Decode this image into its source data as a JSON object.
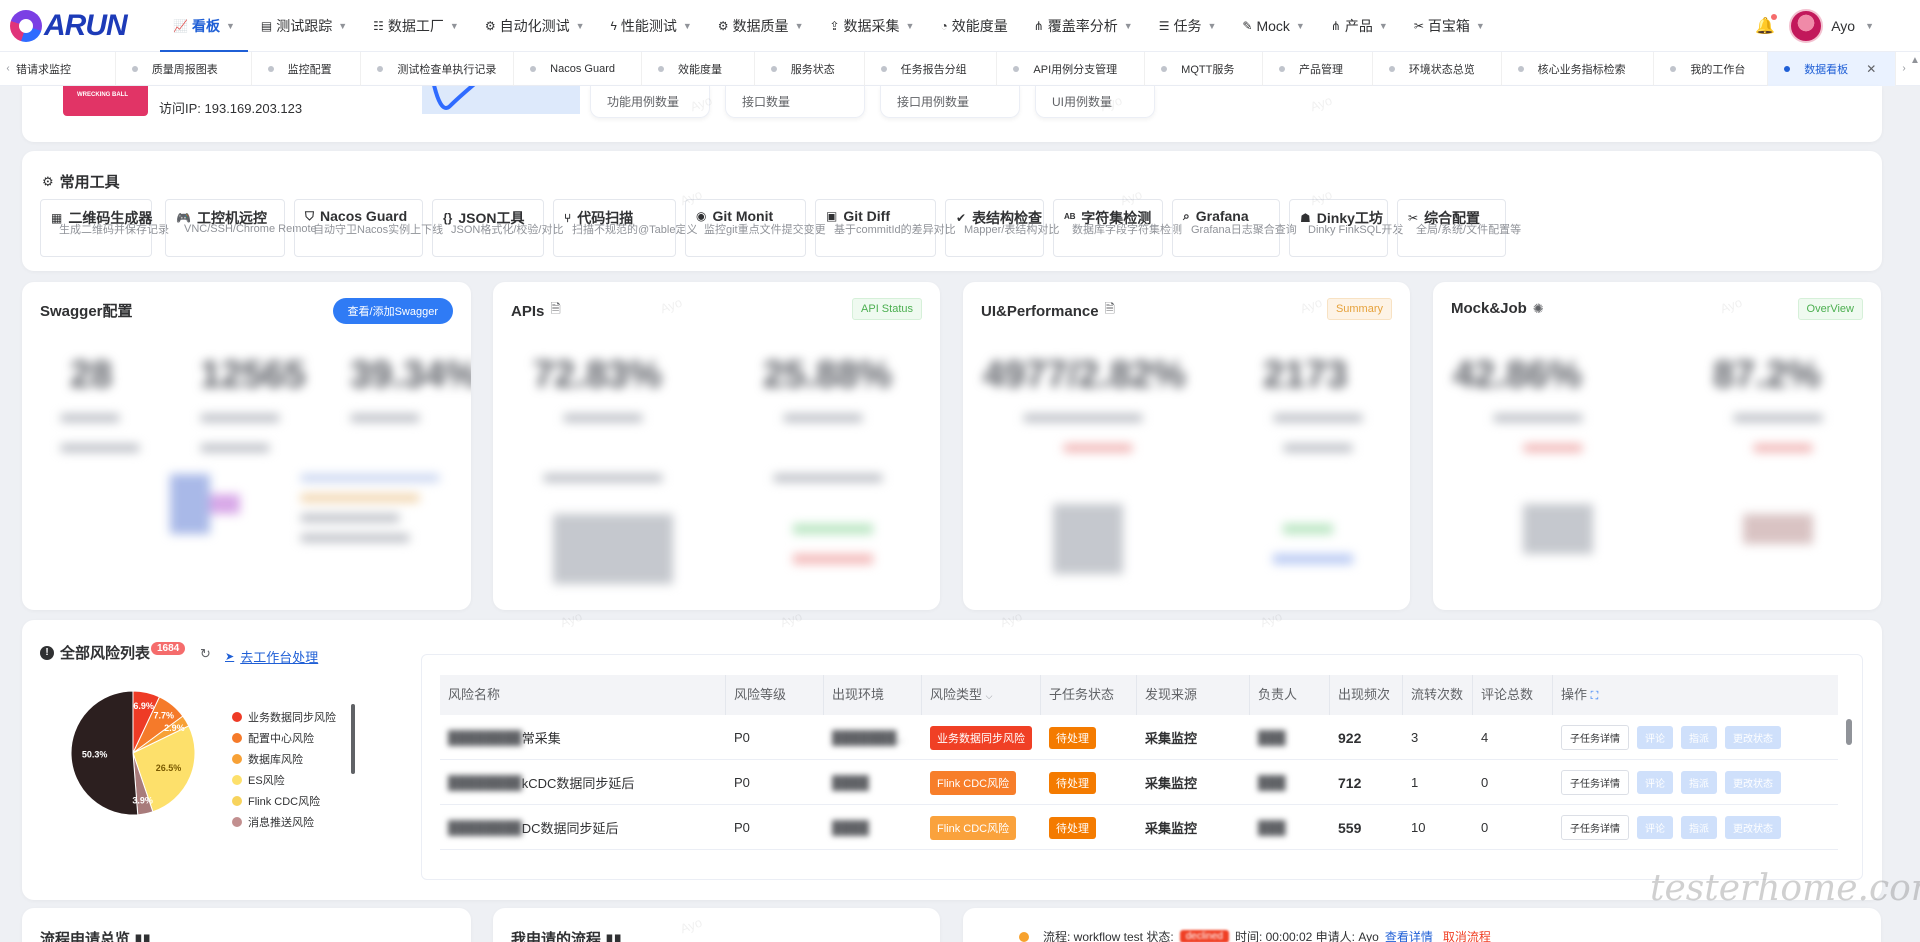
{
  "brand": {
    "logo_text": "ARUN"
  },
  "nav": {
    "items": [
      {
        "icon": "chart-icon",
        "glyph": "📈",
        "label": "看板",
        "active": true,
        "caret": true
      },
      {
        "icon": "doc-icon",
        "glyph": "▤",
        "label": "测试跟踪",
        "caret": true
      },
      {
        "icon": "database-icon",
        "glyph": "☷",
        "label": "数据工厂",
        "caret": true
      },
      {
        "icon": "robot-icon",
        "glyph": "⚙",
        "label": "自动化测试",
        "caret": true
      },
      {
        "icon": "bolt-icon",
        "glyph": "ϟ",
        "label": "性能测试",
        "caret": true
      },
      {
        "icon": "robot-icon",
        "glyph": "⚙",
        "label": "数据质量",
        "caret": true
      },
      {
        "icon": "upload-icon",
        "glyph": "⇪",
        "label": "数据采集",
        "caret": true
      },
      {
        "icon": "pie-icon",
        "glyph": "◔",
        "label": "效能度量",
        "caret": false
      },
      {
        "icon": "nodes-icon",
        "glyph": "⋔",
        "label": "覆盖率分析",
        "caret": true
      },
      {
        "icon": "list-icon",
        "glyph": "☰",
        "label": "任务",
        "caret": true
      },
      {
        "icon": "wand-icon",
        "glyph": "✎",
        "label": "Mock",
        "caret": true
      },
      {
        "icon": "nodes-icon",
        "glyph": "⋔",
        "label": "产品",
        "caret": true
      },
      {
        "icon": "tools-icon",
        "glyph": "✂",
        "label": "百宝箱",
        "caret": true
      }
    ],
    "username": "Ayo"
  },
  "tabs": [
    {
      "label": "错请求监控",
      "dot": false,
      "w": 100
    },
    {
      "label": "质量周报图表",
      "dot": true,
      "w": 136
    },
    {
      "label": "监控配置",
      "dot": true,
      "w": 110
    },
    {
      "label": "测试检查单执行记录",
      "dot": true,
      "w": 153
    },
    {
      "label": "Nacos Guard",
      "dot": true,
      "w": 128
    },
    {
      "label": "效能度量",
      "dot": true,
      "w": 113
    },
    {
      "label": "服务状态",
      "dot": true,
      "w": 110
    },
    {
      "label": "任务报告分组",
      "dot": true,
      "w": 133
    },
    {
      "label": "API用例分支管理",
      "dot": true,
      "w": 148
    },
    {
      "label": "MQTT服务",
      "dot": true,
      "w": 118
    },
    {
      "label": "产品管理",
      "dot": true,
      "w": 110
    },
    {
      "label": "环境状态总览",
      "dot": true,
      "w": 129
    },
    {
      "label": "核心业务指标检索",
      "dot": true,
      "w": 153
    },
    {
      "label": "我的工作台",
      "dot": true,
      "w": 114
    },
    {
      "label": "数据看板",
      "dot": true,
      "w": 128,
      "active": true
    }
  ],
  "profile": {
    "image_text": "WRECKING BALL",
    "ip_label": "访问IP: 193.169.203.123",
    "stats": [
      "功能用例数量",
      "接口数量",
      "接口用例数量",
      "UI用例数量"
    ]
  },
  "tools": {
    "title": "常用工具",
    "items": [
      {
        "name": "二维码生成器",
        "desc": "生成二维码并保存记录",
        "icon": "qrcode-icon",
        "glyph": "▦"
      },
      {
        "name": "工控机远控",
        "desc": "VNC/SSH/Chrome Remote",
        "icon": "gamepad-icon",
        "glyph": "🎮"
      },
      {
        "name": "Nacos Guard",
        "desc": "自动守卫Nacos实例上下线",
        "icon": "shield-icon",
        "glyph": "⛉"
      },
      {
        "name": "JSON工具",
        "desc": "JSON格式化/校验/对比",
        "icon": "json-icon",
        "glyph": "{}"
      },
      {
        "name": "代码扫描",
        "desc": "扫描不规范的@Table定义",
        "icon": "branch-icon",
        "glyph": "⑂"
      },
      {
        "name": "Git Monit",
        "desc": "监控git重点文件提交变更",
        "icon": "cat-icon",
        "glyph": "◉"
      },
      {
        "name": "Git Diff",
        "desc": "基于commitId的差异对比",
        "icon": "diff-icon",
        "glyph": "▣"
      },
      {
        "name": "表结构检查",
        "desc": "Mapper/表结构对比",
        "icon": "check-icon",
        "glyph": "✔"
      },
      {
        "name": "字符集检测",
        "desc": "数据库字段字符集检测",
        "icon": "spell-icon",
        "glyph": "ᴬᴮ"
      },
      {
        "name": "Grafana",
        "desc": "Grafana日志聚合查询",
        "icon": "search-icon",
        "glyph": "⌕"
      },
      {
        "name": "Dinky工坊",
        "desc": "Dinky FinkSQL开发",
        "icon": "ghost-icon",
        "glyph": "☗"
      },
      {
        "name": "综合配置",
        "desc": "全局/系统/文件配置等",
        "icon": "wrench-icon",
        "glyph": "✂"
      }
    ]
  },
  "panels": {
    "swagger": {
      "title": "Swagger配置",
      "button": "查看/添加Swagger"
    },
    "apis": {
      "title": "APIs",
      "tag": "API Status"
    },
    "ui": {
      "title": "UI&Performance",
      "tag": "Summary"
    },
    "mock": {
      "title": "Mock&Job",
      "tag": "OverView"
    }
  },
  "risk": {
    "title": "全部风险列表",
    "count": "1684",
    "goto_label": "去工作台处理",
    "chart_data": {
      "type": "pie",
      "slices": [
        {
          "label": "业务数据同步风险",
          "value": 6.9,
          "color": "#ee3b26"
        },
        {
          "label": "配置中心风险",
          "value": 7.7,
          "color": "#f57a2a"
        },
        {
          "label": "数据库风险",
          "value": 2.9,
          "color": "#f7a136"
        },
        {
          "label": "ES风险",
          "value": 26.5,
          "color": "#fde06b"
        },
        {
          "label": "Flink CDC风险",
          "value": 3.9,
          "color": "#a87b7b"
        },
        {
          "label": "消息推送风险",
          "value": 50.3,
          "color": "#2c1f1f"
        }
      ],
      "data_labels": [
        "6.9%",
        "7.7%",
        "2.9%",
        "26.5%",
        "3.9%",
        "50.3%"
      ],
      "legend_placement": "right"
    },
    "legend": [
      {
        "label": "业务数据同步风险",
        "color": "#ee3b26"
      },
      {
        "label": "配置中心风险",
        "color": "#f57a2a"
      },
      {
        "label": "数据库风险",
        "color": "#f7a136"
      },
      {
        "label": "ES风险",
        "color": "#fde06b"
      },
      {
        "label": "Flink CDC风险",
        "color": "#f7d35c"
      },
      {
        "label": "消息推送风险",
        "color": "#c28f8f"
      }
    ],
    "columns": [
      "风险名称",
      "风险等级",
      "出现环境",
      "风险类型",
      "子任务状态",
      "发现来源",
      "负责人",
      "出现频次",
      "流转次数",
      "评论总数",
      "操作"
    ],
    "rows": [
      {
        "name_tail": "常采集",
        "level": "P0",
        "type": "业务数据同步风险",
        "type_color": "red",
        "status": "待处理",
        "source": "采集监控",
        "freq": "922",
        "flow": "3",
        "comments": "4"
      },
      {
        "name_tail": "kCDC数据同步延后",
        "level": "P0",
        "type": "Flink CDC风险",
        "type_color": "orange",
        "status": "待处理",
        "source": "采集监控",
        "freq": "712",
        "flow": "1",
        "comments": "0"
      },
      {
        "name_tail": "DC数据同步延后",
        "level": "P0",
        "type": "Flink CDC风险",
        "type_color": "lorange",
        "status": "待处理",
        "source": "采集监控",
        "freq": "559",
        "flow": "10",
        "comments": "0"
      }
    ],
    "actions": [
      "子任务详情",
      "评论",
      "指派",
      "更改状态"
    ]
  },
  "bottom": {
    "left_title": "流程申请总览",
    "mid_title": "我申请的流程",
    "flow_prefix": "流程: workflow test 状态:",
    "flow_status": "declined",
    "flow_time": "时间: 00:00:02 申请人: Ayo",
    "flow_link": "查看详情",
    "flow_cancel": "取消流程"
  },
  "watermark_text": "Ayo",
  "site_watermark": "testerhome.com"
}
